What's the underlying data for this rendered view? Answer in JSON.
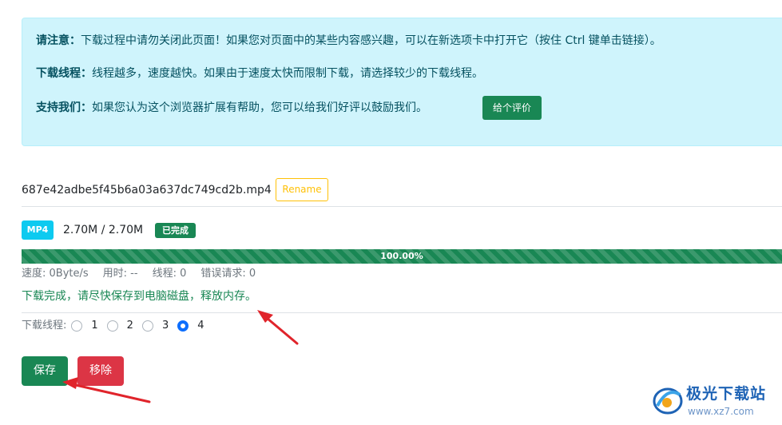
{
  "notice": {
    "attention_label": "请注意：",
    "attention_text": "下载过程中请勿关闭此页面！如果您对页面中的某些内容感兴趣，可以在新选项卡中打开它（按住 Ctrl 键单击链接）。",
    "threads_label": "下载线程：",
    "threads_text": "线程越多，速度越快。如果由于速度太快而限制下载，请选择较少的下载线程。",
    "support_label": "支持我们：",
    "support_text": "如果您认为这个浏览器扩展有帮助，您可以给我们好评以鼓励我们。",
    "rate_button": "给个评价"
  },
  "file": {
    "name": "687e42adbe5f45b6a03a637dc749cd2b.mp4",
    "rename_button": "Rename",
    "format": "MP4",
    "size": "2.70M / 2.70M",
    "status": "已完成",
    "progress_percent": 100,
    "progress_label": "100.00%"
  },
  "stats": {
    "speed": "速度: 0Byte/s",
    "elapsed": "用时: --",
    "threads": "线程: 0",
    "errors": "错误请求: 0"
  },
  "done_message": "下载完成，请尽快保存到电脑磁盘，释放内存。",
  "thread_select": {
    "label": "下载线程:",
    "options": [
      "1",
      "2",
      "3",
      "4"
    ],
    "selected": "4"
  },
  "actions": {
    "save": "保存",
    "remove": "移除"
  },
  "colors": {
    "success": "#198754",
    "danger": "#dc3545",
    "info_bg": "#cff4fc",
    "info": "#0dcaf0",
    "warning": "#ffc107",
    "primary": "#0d6efd",
    "annotation_arrow": "#e0242b"
  },
  "watermark": {
    "title": "极光下载站",
    "url": "www.xz7.com"
  }
}
